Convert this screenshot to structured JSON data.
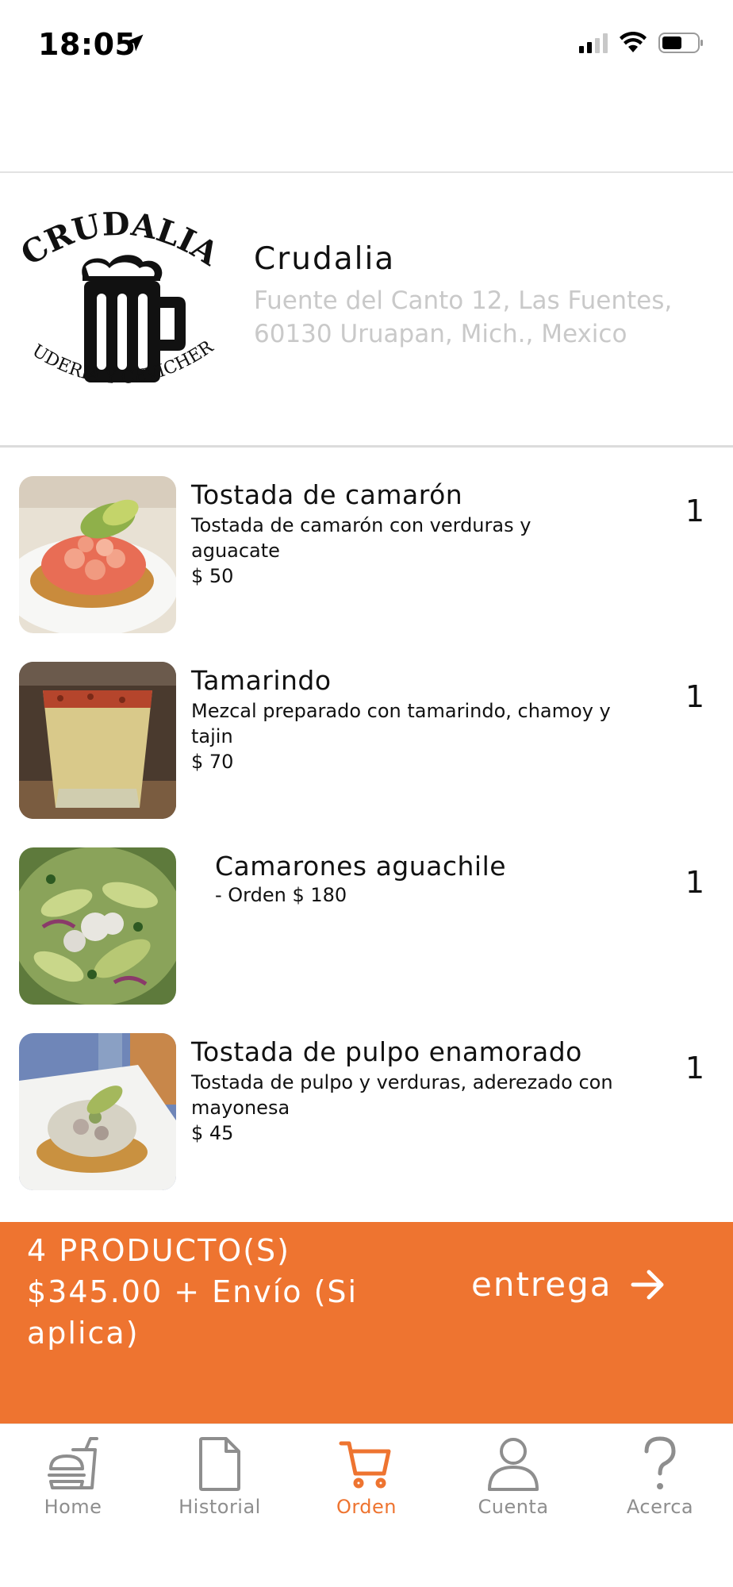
{
  "status_bar": {
    "time": "18:05",
    "location_icon": "location-arrow-icon",
    "signal_icon": "cellular-signal-icon",
    "wifi_icon": "wifi-icon",
    "battery_icon": "battery-icon"
  },
  "restaurant": {
    "logo_icon": "crudalia-logo-beer-mug",
    "logo_text_top": ".CRUDALIA.",
    "logo_text_bottom": "·CRUDERIA Y CEVICHERIA·",
    "name": "Crudalia",
    "address": "Fuente del Canto 12, Las Fuentes, 60130 Uruapan, Mich., Mexico"
  },
  "items": [
    {
      "name": "Tostada de camarón",
      "description": "Tostada de camarón con verduras y aguacate",
      "price": "$ 50",
      "quantity": "1",
      "image_icon": "shrimp-tostada-photo"
    },
    {
      "name": "Tamarindo",
      "description": "Mezcal preparado con tamarindo, chamoy y tajin",
      "price": "$ 70",
      "quantity": "1",
      "image_icon": "tamarind-drink-photo"
    },
    {
      "name": "Camarones aguachile",
      "description": "",
      "price": "- Orden $ 180",
      "quantity": "1",
      "image_icon": "aguachile-photo"
    },
    {
      "name": "Tostada de pulpo enamorado",
      "description": "Tostada de pulpo y verduras, aderezado con mayonesa",
      "price": "$ 45",
      "quantity": "1",
      "image_icon": "octopus-tostada-photo"
    }
  ],
  "summary": {
    "count": "4 PRODUCTO(S)",
    "total": "$345.00 + Envío (Si aplica)",
    "cta_label": "entrega",
    "cta_icon": "arrow-right-icon"
  },
  "tabs": [
    {
      "label": "Home",
      "icon": "burger-drink-icon",
      "active": false
    },
    {
      "label": "Historial",
      "icon": "document-icon",
      "active": false
    },
    {
      "label": "Orden",
      "icon": "cart-icon",
      "active": true
    },
    {
      "label": "Cuenta",
      "icon": "user-icon",
      "active": false
    },
    {
      "label": "Acerca",
      "icon": "question-icon",
      "active": false
    }
  ],
  "colors": {
    "accent": "#ee7430",
    "inactive_tab": "#8e8e8e",
    "address_text": "#c9c9c9"
  }
}
